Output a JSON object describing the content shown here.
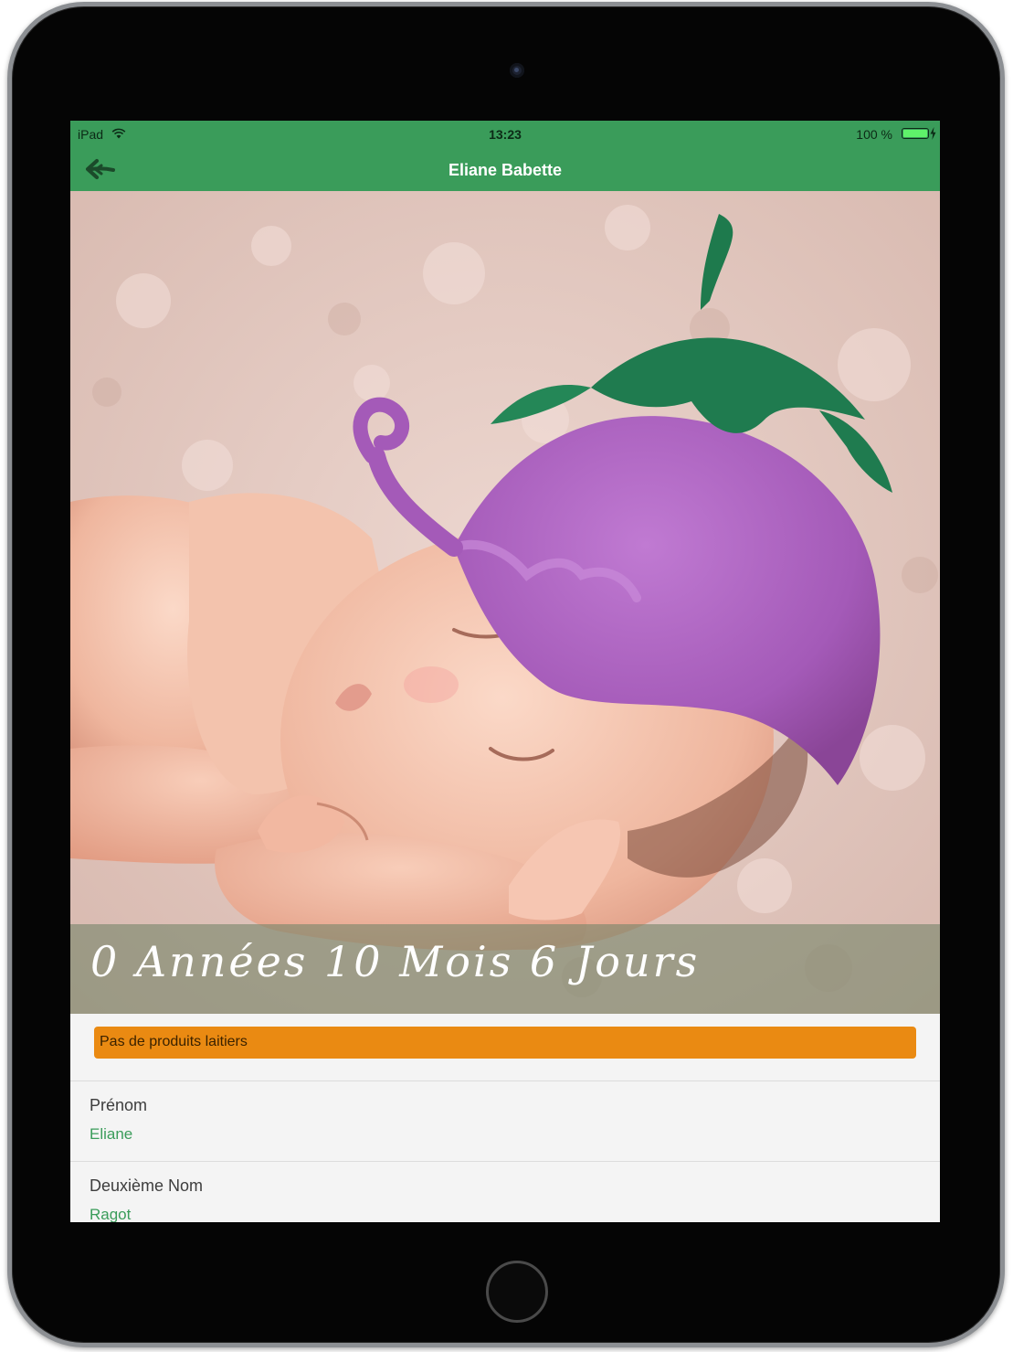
{
  "status_bar": {
    "carrier": "iPad",
    "time": "13:23",
    "battery": "100 %"
  },
  "nav": {
    "title": "Eliane Babette",
    "back_icon": "arrow-left-icon"
  },
  "hero": {
    "age_text": "0 Années 10 Mois 6 Jours"
  },
  "alert": {
    "label": "Pas de produits laitiers",
    "color": "#ea8a12"
  },
  "fields": [
    {
      "label": "Prénom",
      "value": "Eliane"
    },
    {
      "label": "Deuxième Nom",
      "value": "Ragot"
    }
  ],
  "colors": {
    "accent": "#3a9c5a",
    "value_text": "#3a9c5a"
  }
}
